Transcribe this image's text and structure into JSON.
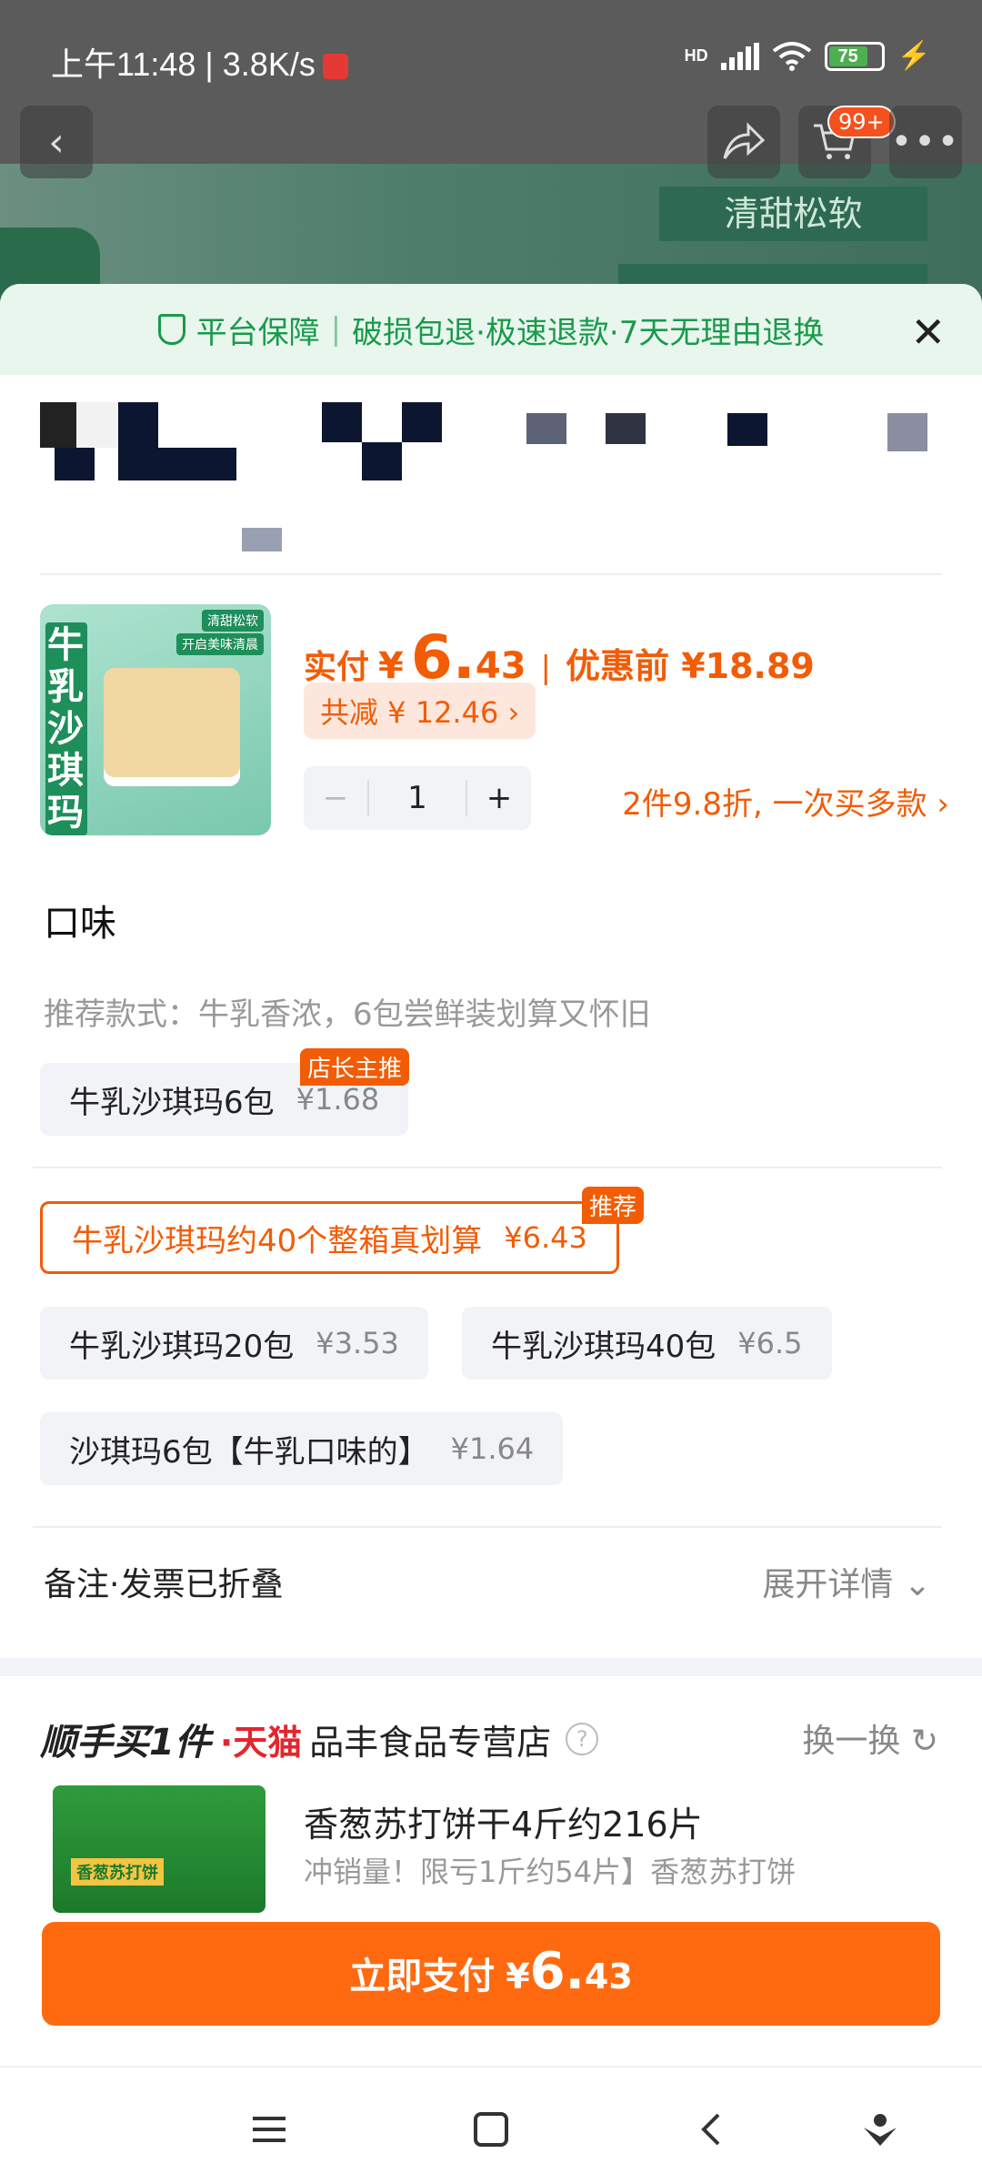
{
  "status_bar": {
    "time": "上午11:48 | 3.8K/s",
    "battery": "75"
  },
  "background": {
    "tag": "清甜松软",
    "cart_badge": "99+"
  },
  "guarantee": {
    "title": "平台保障",
    "items": "破损包退·极速退款·7天无理由退换"
  },
  "product": {
    "thumb_vertical": "牛乳沙琪玛",
    "thumb_tag1": "清甜松软",
    "thumb_tag2": "开启美味清晨",
    "pay_label": "实付",
    "currency": "¥",
    "price_int": "6.",
    "price_dec": "43",
    "before_label": "优惠前 ¥18.89",
    "savings": "共减 ¥ 12.46 ›",
    "quantity": "1",
    "promo": "2件9.8折, 一次买多款 ›"
  },
  "flavor": {
    "title": "口味",
    "recommended": "推荐款式：牛乳香浓，6包尝鲜装划算又怀旧",
    "options": [
      {
        "label": "牛乳沙琪玛6包",
        "price": "¥1.68",
        "badge": "店长主推"
      },
      {
        "label": "牛乳沙琪玛约40个整箱真划算",
        "price": "¥6.43",
        "badge": "推荐"
      },
      {
        "label": "牛乳沙琪玛20包",
        "price": "¥3.53"
      },
      {
        "label": "牛乳沙琪玛40包",
        "price": "¥6.5"
      },
      {
        "label": "沙琪玛6包【牛乳口味的】",
        "price": "¥1.64"
      }
    ]
  },
  "notes": {
    "label": "备注·发票已折叠",
    "expand": "展开详情 ⌄"
  },
  "buy_one": {
    "title": "顺手买1件",
    "platform": "·天猫",
    "shop": "品丰食品专营店",
    "help": "?",
    "swap": "换一换 ↻",
    "img_label": "香葱苏打饼",
    "name": "香葱苏打饼干4斤约216片",
    "desc": "冲销量！限亏1斤约54片】香葱苏打饼"
  },
  "pay_button": {
    "label": "立即支付",
    "currency": "¥",
    "price_int": "6.",
    "price_dec": "43"
  },
  "colors": {
    "accent": "#f25c05",
    "pay_button": "#ff6a10",
    "guarantee_green": "#1a9a4b"
  }
}
